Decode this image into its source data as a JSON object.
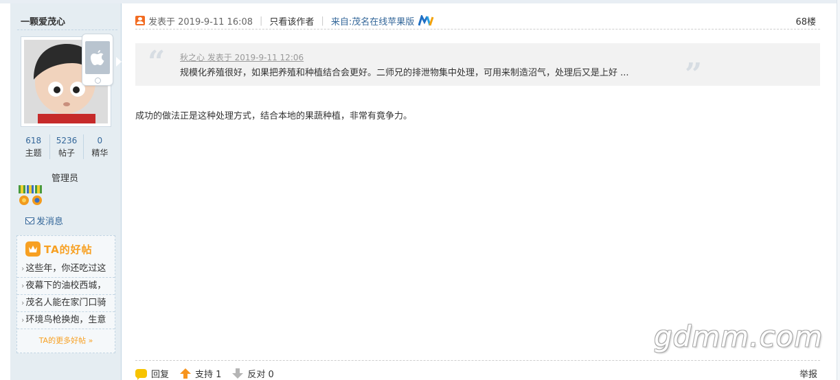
{
  "author": {
    "name": "一颗爱茂心",
    "stats": [
      {
        "value": "618",
        "label": "主题"
      },
      {
        "value": "5236",
        "label": "帖子"
      },
      {
        "value": "0",
        "label": "精华"
      }
    ],
    "role": "管理员",
    "send_message": "发消息"
  },
  "good_posts": {
    "title": "TA的好帖",
    "items": [
      {
        "label": "这些年，你还吃过这"
      },
      {
        "label": "夜幕下的油校西城，"
      },
      {
        "label": "茂名人能在家门口骑"
      },
      {
        "label": "环境鸟枪换炮，生意"
      }
    ],
    "more": "TA的更多好帖 »"
  },
  "post": {
    "posted_at": "发表于 2019-9-11 16:08",
    "only_author": "只看该作者",
    "source": "来自:茂名在线苹果版",
    "floor": "68楼",
    "quote": {
      "meta": "秋之心 发表于 2019-9-11 12:06",
      "text": "规模化养殖很好，如果把养殖和种植结合会更好。二师兄的排泄物集中处理，可用来制造沼气，处理后又是上好 ..."
    },
    "body": "成功的做法正是这种处理方式，结合本地的果蔬种植，非常有竟争力。"
  },
  "footer": {
    "reply": "回复",
    "support": "支持 1",
    "oppose": "反对 0",
    "report": "举报"
  },
  "watermark": "gdmm.com",
  "colors": {
    "accent": "#336699",
    "brand_orange": "#f7a022",
    "sidebar_bg": "#e5edf2"
  }
}
